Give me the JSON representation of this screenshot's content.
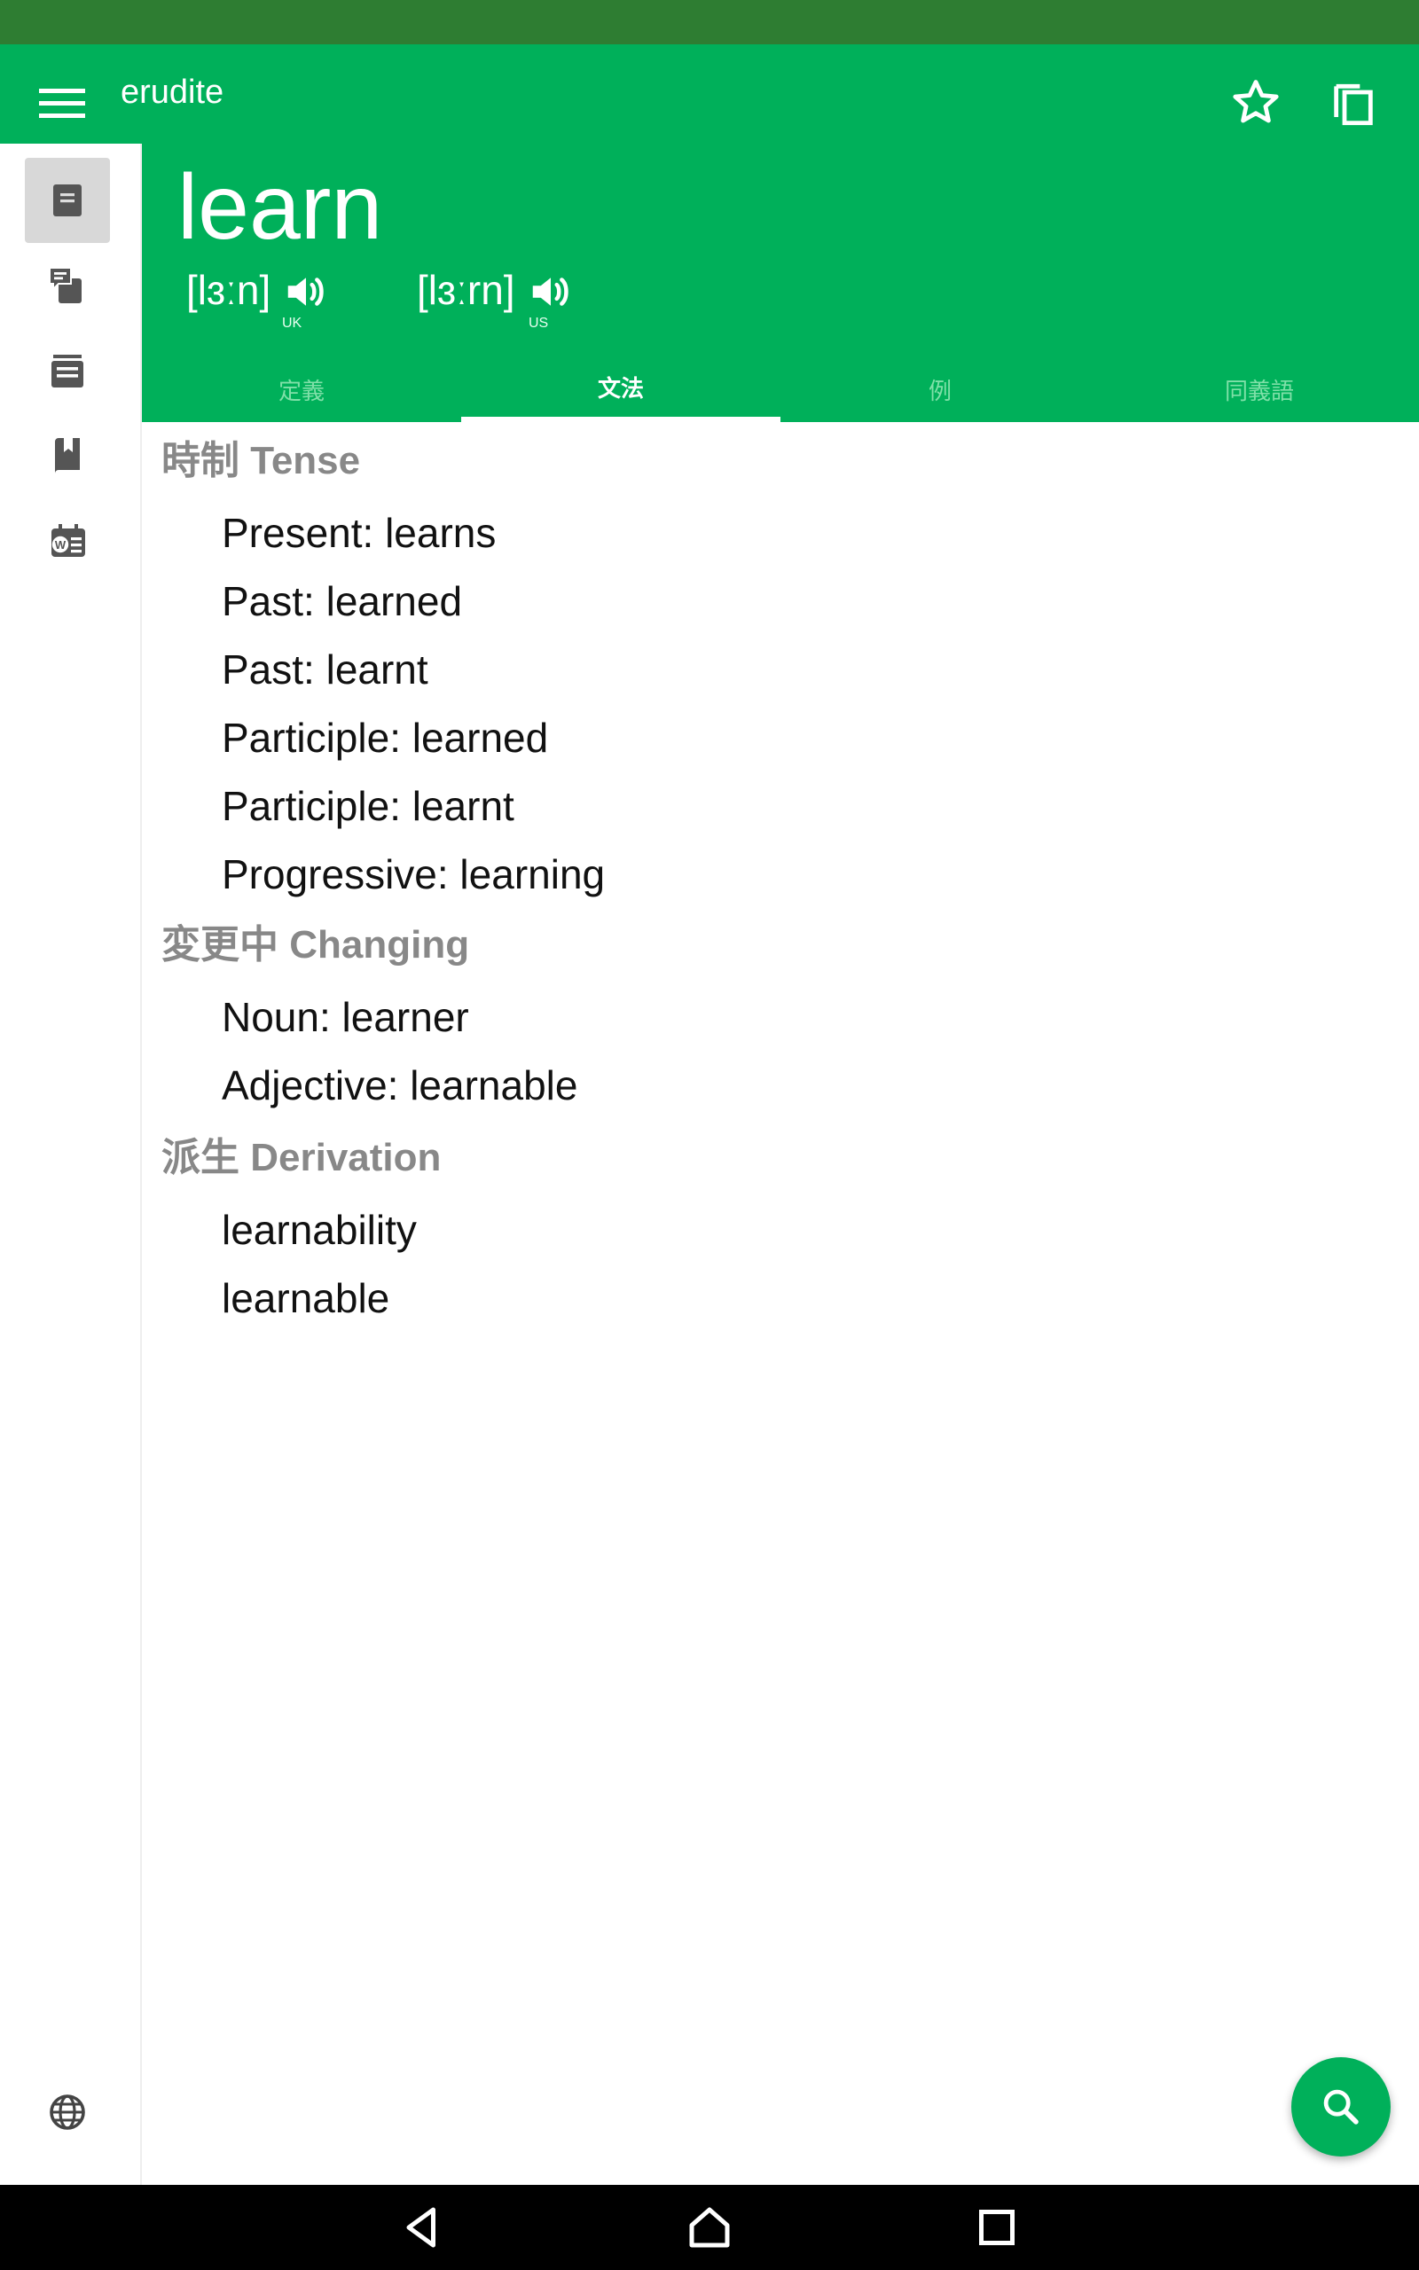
{
  "app": {
    "title": "erudite",
    "colors": {
      "primary": "#00b05a",
      "status_bar": "#2e7d32",
      "section_title": "#888888"
    }
  },
  "toolbar": {
    "menu_icon": "hamburger-menu-icon",
    "favorite_icon": "star-outline-icon",
    "copy_icon": "copy-icon"
  },
  "word": {
    "headword": "learn",
    "pronunciations": [
      {
        "ipa": "[lɜːn]",
        "region": "UK"
      },
      {
        "ipa": "[lɜːrn]",
        "region": "US"
      }
    ]
  },
  "tabs": [
    {
      "label": "定義",
      "active": false
    },
    {
      "label": "文法",
      "active": true
    },
    {
      "label": "例",
      "active": false
    },
    {
      "label": "同義語",
      "active": false
    }
  ],
  "sidebar": {
    "items": [
      {
        "icon": "document-icon",
        "selected": true
      },
      {
        "icon": "comment-cards-icon",
        "selected": false
      },
      {
        "icon": "list-stack-icon",
        "selected": false
      },
      {
        "icon": "bookmark-book-icon",
        "selected": false
      },
      {
        "icon": "word-calendar-icon",
        "selected": false
      }
    ],
    "bottom_icon": "globe-icon"
  },
  "grammar": {
    "sections": [
      {
        "title": "時制 Tense",
        "items": [
          "Present: learns",
          "Past: learned",
          "Past: learnt",
          "Participle: learned",
          "Participle: learnt",
          "Progressive: learning"
        ]
      },
      {
        "title": "変更中 Changing",
        "items": [
          "Noun: learner",
          "Adjective: learnable"
        ]
      },
      {
        "title": "派生 Derivation",
        "items": [
          "learnability",
          "learnable"
        ]
      }
    ]
  },
  "fab": {
    "icon": "search-icon"
  },
  "navigation": {
    "buttons": [
      "back-icon",
      "home-icon",
      "recents-icon"
    ]
  }
}
